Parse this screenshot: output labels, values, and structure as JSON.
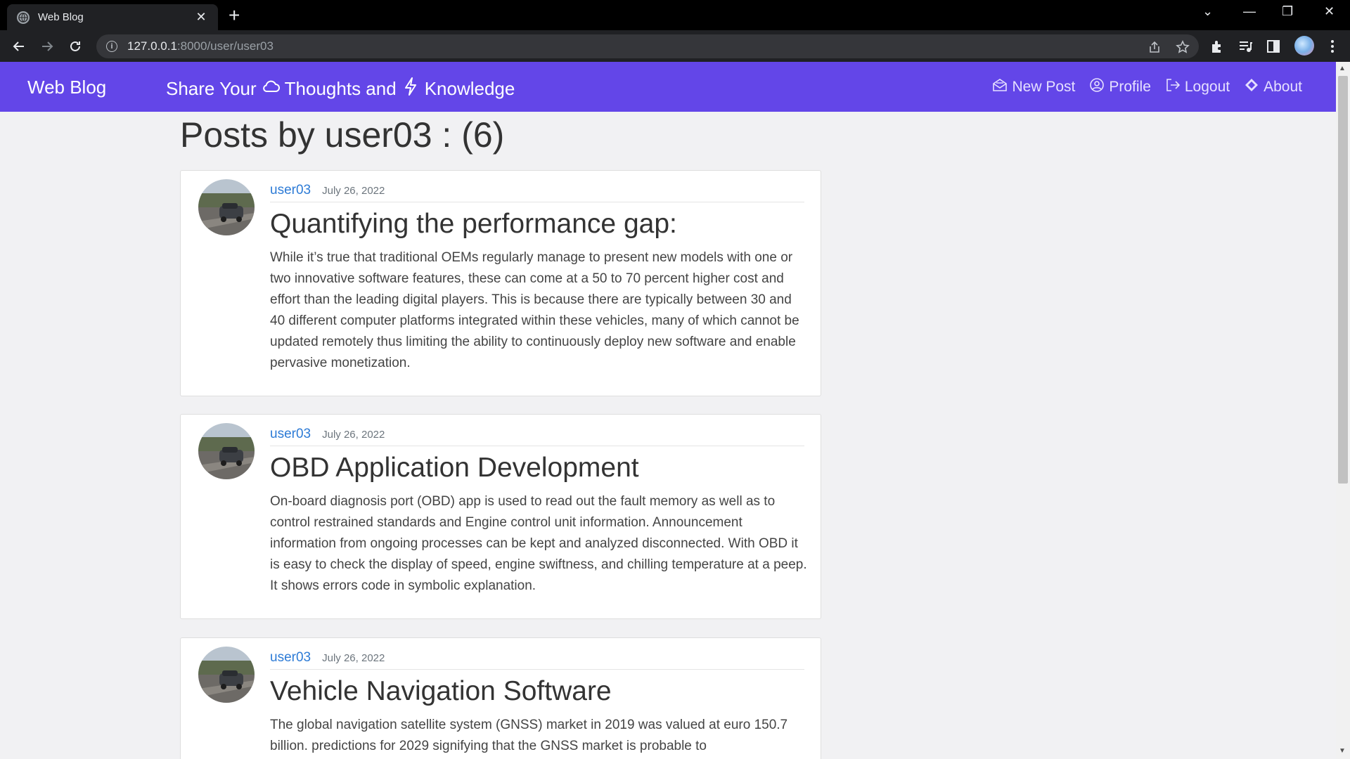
{
  "browser": {
    "tab_title": "Web Blog",
    "url_host": "127.0.0.1",
    "url_path": ":8000/user/user03"
  },
  "navbar": {
    "brand": "Web Blog",
    "tagline_part1": "Share Your",
    "tagline_part2": "Thoughts and",
    "tagline_part3": "Knowledge",
    "links": {
      "new_post": "New Post",
      "profile": "Profile",
      "logout": "Logout",
      "about": "About"
    }
  },
  "page": {
    "title": "Posts by user03 : (6)"
  },
  "posts": [
    {
      "author": "user03",
      "date": "July 26, 2022",
      "title": "Quantifying the performance gap:",
      "body": "While it’s true that traditional OEMs regularly manage to present new models with one or two innovative software features, these can come at a 50 to 70 percent higher cost and effort than the leading digital players. This is because there are typically between 30 and 40 different computer platforms integrated within these vehicles, many of which cannot be updated remotely thus limiting the ability to continuously deploy new software and enable pervasive monetization."
    },
    {
      "author": "user03",
      "date": "July 26, 2022",
      "title": "OBD Application Development",
      "body": "On-board diagnosis port (OBD) app is used to read out the fault memory as well as to control restrained standards and Engine control unit information. Announcement information from ongoing processes can be kept and analyzed disconnected. With OBD it is easy to check the display of speed, engine swiftness, and chilling temperature at a peep. It shows errors code in symbolic explanation."
    },
    {
      "author": "user03",
      "date": "July 26, 2022",
      "title": "Vehicle Navigation Software",
      "body": "The global navigation satellite system (GNSS) market in 2019 was valued at euro 150.7 billion. predictions for 2029 signifying that the GNSS market is probable to"
    }
  ]
}
